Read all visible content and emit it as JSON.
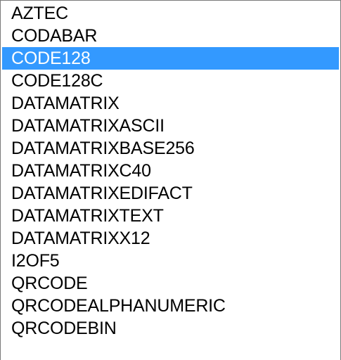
{
  "listbox": {
    "selected_index": 2,
    "selected_background": "#3399ff",
    "selected_text_color": "#ffffff",
    "items": [
      {
        "label": "AZTEC"
      },
      {
        "label": "CODABAR"
      },
      {
        "label": "CODE128"
      },
      {
        "label": "CODE128C"
      },
      {
        "label": "DATAMATRIX"
      },
      {
        "label": "DATAMATRIXASCII"
      },
      {
        "label": "DATAMATRIXBASE256"
      },
      {
        "label": "DATAMATRIXC40"
      },
      {
        "label": "DATAMATRIXEDIFACT"
      },
      {
        "label": "DATAMATRIXTEXT"
      },
      {
        "label": "DATAMATRIXX12"
      },
      {
        "label": "I2OF5"
      },
      {
        "label": "QRCODE"
      },
      {
        "label": "QRCODEALPHANUMERIC"
      },
      {
        "label": "QRCODEBIN"
      }
    ]
  }
}
